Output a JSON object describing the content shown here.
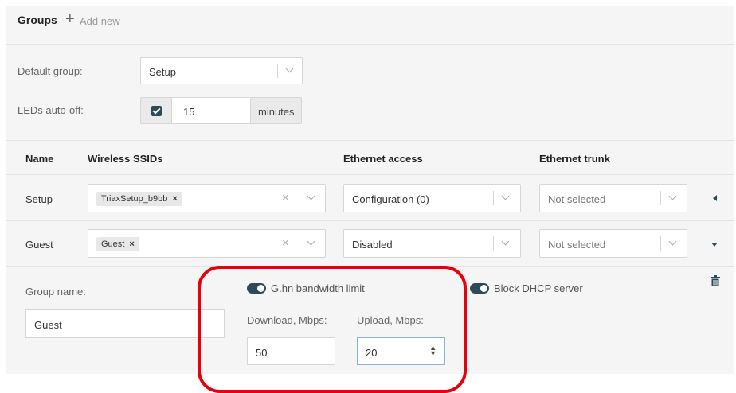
{
  "header": {
    "title": "Groups",
    "add_new_label": "Add new"
  },
  "settings": {
    "default_group_label": "Default group:",
    "default_group_value": "Setup",
    "leds_label": "LEDs auto-off:",
    "leds_checked": true,
    "leds_value": "15",
    "leds_unit": "minutes"
  },
  "table": {
    "columns": [
      "Name",
      "Wireless SSIDs",
      "Ethernet access",
      "Ethernet trunk"
    ],
    "rows": [
      {
        "name": "Setup",
        "ssid_tag": "TriaxSetup_b9bb",
        "ethernet_access": "Configuration (0)",
        "ethernet_trunk": "Not selected",
        "expanded": false
      },
      {
        "name": "Guest",
        "ssid_tag": "Guest",
        "ethernet_access": "Disabled",
        "ethernet_trunk": "Not selected",
        "expanded": true
      }
    ],
    "tag_remove": "×"
  },
  "detail": {
    "group_name_label": "Group name:",
    "group_name_value": "Guest",
    "ghn_label": "G.hn bandwidth limit",
    "ghn_enabled": true,
    "download_label": "Download, Mbps:",
    "download_value": "50",
    "upload_label": "Upload, Mbps:",
    "upload_value": "20",
    "dhcp_label": "Block DHCP server",
    "dhcp_enabled": true
  },
  "icons": {
    "add": "plus-icon",
    "delete": "trash-icon",
    "collapse": "caret-left-icon",
    "expand": "caret-down-icon"
  },
  "colors": {
    "accent": "#2b4a5a",
    "highlight": "#e8000b",
    "panel": "#f5f5f5"
  }
}
